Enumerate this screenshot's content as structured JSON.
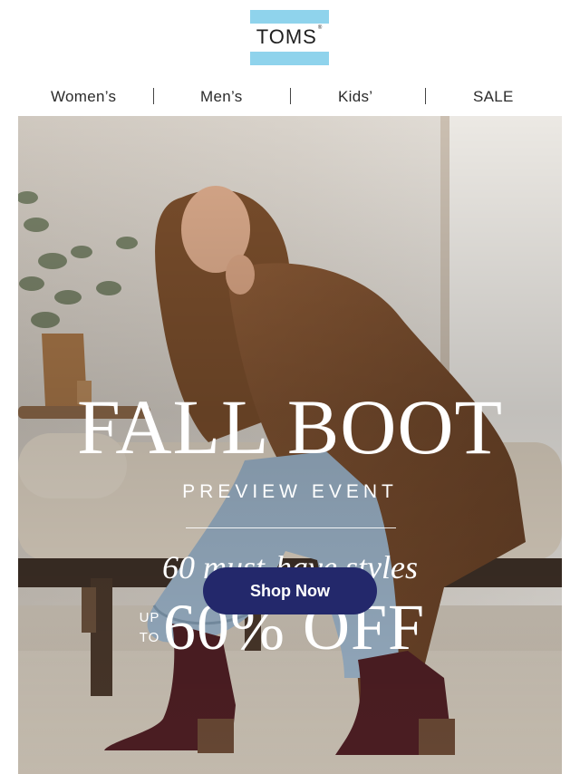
{
  "brand": {
    "logo_text": "TOMS",
    "logo_mark": "®",
    "logo_band_color": "#8fd3ec"
  },
  "nav": {
    "items": [
      {
        "label": "Women’s"
      },
      {
        "label": "Men’s"
      },
      {
        "label": "Kids’"
      },
      {
        "label": "SALE"
      }
    ]
  },
  "hero": {
    "title": "FALL BOOT",
    "subtitle": "PREVIEW EVENT",
    "tagline": "60 must-have styles",
    "up_to_line1": "UP",
    "up_to_line2": "TO",
    "discount": "60% OFF",
    "cta_label": "Shop Now",
    "cta_color": "#23286b"
  }
}
